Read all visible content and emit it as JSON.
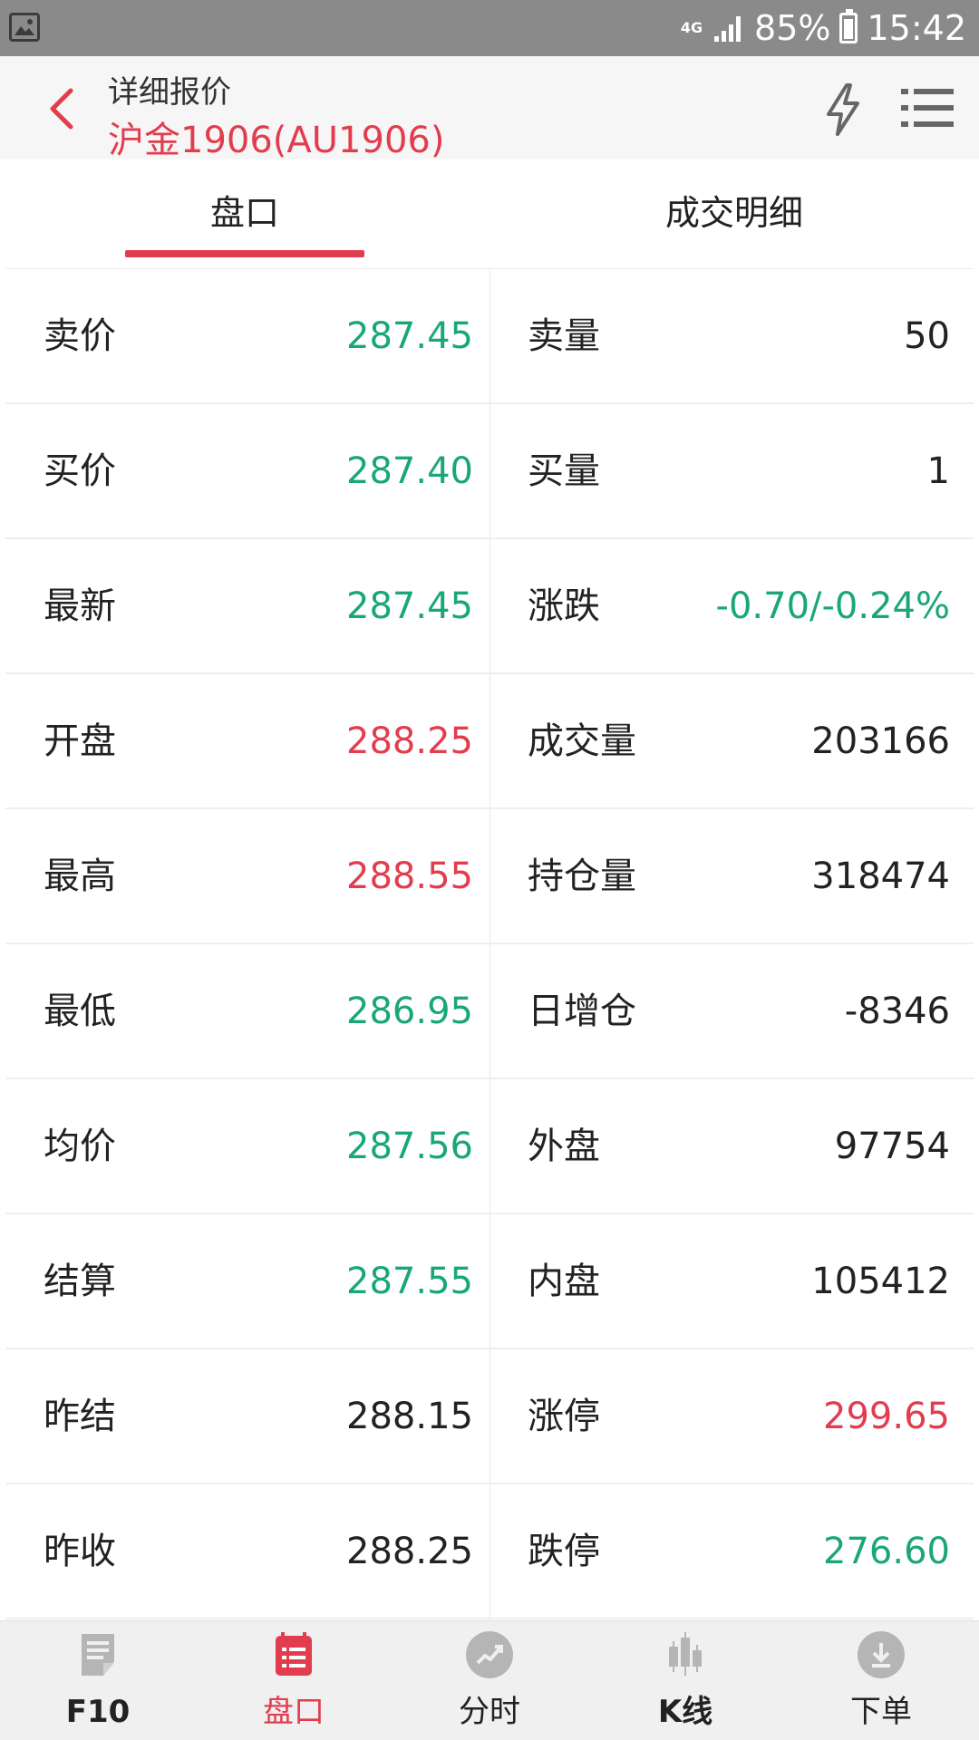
{
  "status_bar": {
    "network": "4G",
    "battery": "85%",
    "time": "15:42"
  },
  "header": {
    "title": "详细报价",
    "subtitle": "沪金1906(AU1906)"
  },
  "tabs": [
    {
      "label": "盘口",
      "active": true
    },
    {
      "label": "成交明细",
      "active": false
    }
  ],
  "colors": {
    "accent": "#e23d4f",
    "up": "#e23d4f",
    "down": "#1aa777",
    "neutral": "#222222"
  },
  "rows": [
    {
      "left_label": "卖价",
      "left_value": "287.45",
      "left_color": "down",
      "right_label": "卖量",
      "right_value": "50",
      "right_color": "neutral"
    },
    {
      "left_label": "买价",
      "left_value": "287.40",
      "left_color": "down",
      "right_label": "买量",
      "right_value": "1",
      "right_color": "neutral"
    },
    {
      "left_label": "最新",
      "left_value": "287.45",
      "left_color": "down",
      "right_label": "涨跌",
      "right_value": "-0.70/-0.24%",
      "right_color": "down"
    },
    {
      "left_label": "开盘",
      "left_value": "288.25",
      "left_color": "up",
      "right_label": "成交量",
      "right_value": "203166",
      "right_color": "neutral"
    },
    {
      "left_label": "最高",
      "left_value": "288.55",
      "left_color": "up",
      "right_label": "持仓量",
      "right_value": "318474",
      "right_color": "neutral"
    },
    {
      "left_label": "最低",
      "left_value": "286.95",
      "left_color": "down",
      "right_label": "日增仓",
      "right_value": "-8346",
      "right_color": "neutral"
    },
    {
      "left_label": "均价",
      "left_value": "287.56",
      "left_color": "down",
      "right_label": "外盘",
      "right_value": "97754",
      "right_color": "neutral"
    },
    {
      "left_label": "结算",
      "left_value": "287.55",
      "left_color": "down",
      "right_label": "内盘",
      "right_value": "105412",
      "right_color": "neutral"
    },
    {
      "left_label": "昨结",
      "left_value": "288.15",
      "left_color": "neutral",
      "right_label": "涨停",
      "right_value": "299.65",
      "right_color": "up"
    },
    {
      "left_label": "昨收",
      "left_value": "288.25",
      "left_color": "neutral",
      "right_label": "跌停",
      "right_value": "276.60",
      "right_color": "down"
    }
  ],
  "bottom_nav": [
    {
      "label": "F10",
      "icon": "document-icon",
      "active": false
    },
    {
      "label": "盘口",
      "icon": "list-icon",
      "active": true
    },
    {
      "label": "分时",
      "icon": "trend-icon",
      "active": false
    },
    {
      "label": "K线",
      "icon": "candlestick-icon",
      "active": false
    },
    {
      "label": "下单",
      "icon": "download-icon",
      "active": false
    }
  ]
}
